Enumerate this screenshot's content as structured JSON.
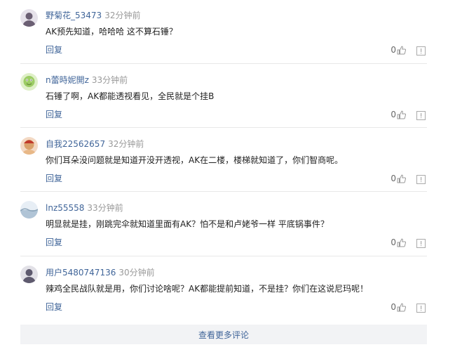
{
  "comments": [
    {
      "user": "野菊花_53473",
      "time": "32分钟前",
      "text": "AK预先知道，哈哈哈 这不算石锤？",
      "reply": "回复",
      "likes": "0",
      "avatar_color": "#6b5f73"
    },
    {
      "user": "n蕾時妮開z",
      "time": "33分钟前",
      "text": "石锤了啊，AK都能透视看见，全民就是个挂B",
      "reply": "回复",
      "likes": "0",
      "avatar_color": "#9ccc65"
    },
    {
      "user": "自我22562657",
      "time": "32分钟前",
      "text": "你们耳朵没问题就是知道开没开透视，AK在二楼，楼梯就知道了，你们智商呢。",
      "reply": "回复",
      "likes": "0",
      "avatar_color": "#d9a06a"
    },
    {
      "user": "lnz55558",
      "time": "33分钟前",
      "text": "明显就是挂，刚跳完伞就知道里面有AK？怕不是和卢姥爷一样 平底锅事件？",
      "reply": "回复",
      "likes": "0",
      "avatar_color": "#b0c4d6"
    },
    {
      "user": "用户5480747136",
      "time": "30分钟前",
      "text": "辣鸡全民战队就是用，你们讨论啥呢？AK都能提前知道，不是挂？你们在这说尼玛呢！",
      "reply": "回复",
      "likes": "0",
      "avatar_color": "#5e5a6e"
    }
  ],
  "load_more": "查看更多评论",
  "colors": {
    "link": "#406599",
    "muted": "#999999",
    "button_bg": "#f2f3f5"
  },
  "icons": {
    "like": "thumbs-up-icon",
    "report": "report-icon"
  }
}
